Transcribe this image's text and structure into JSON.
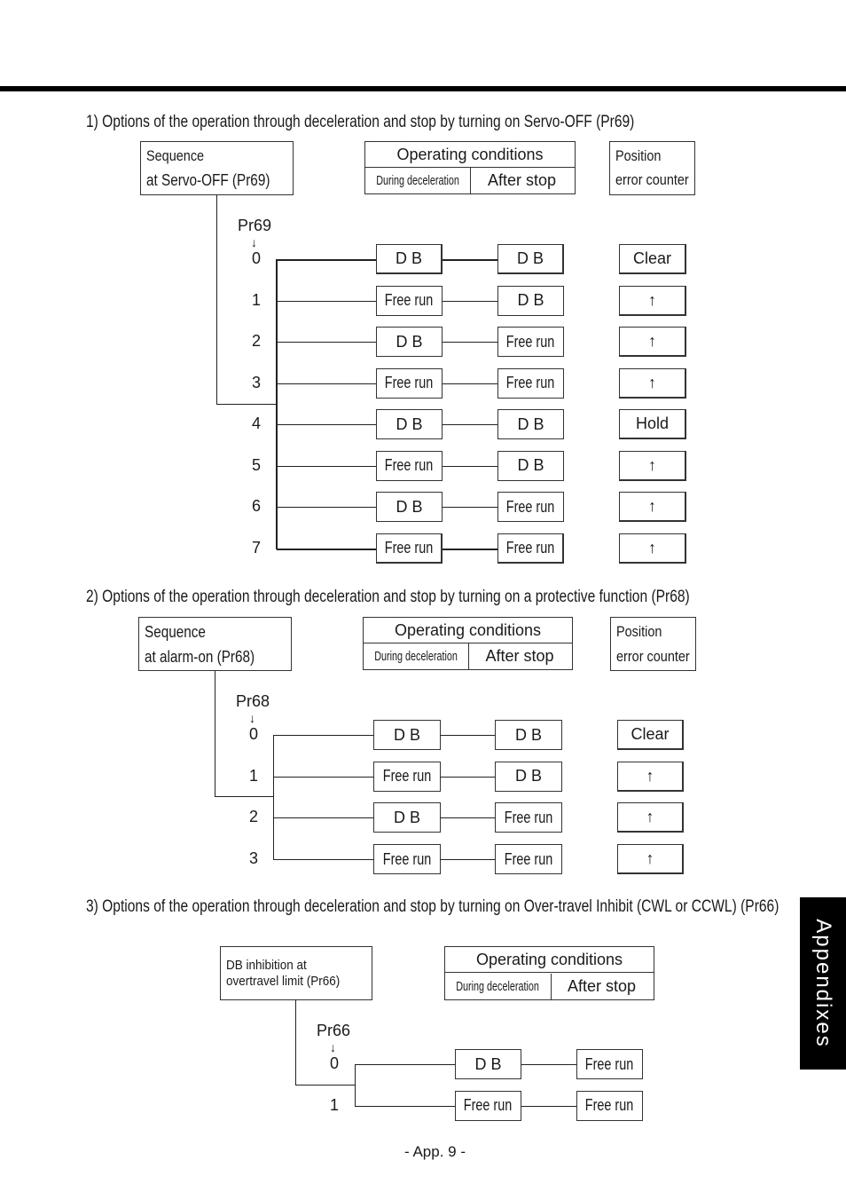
{
  "page": {
    "footer": "- App. 9 -",
    "side_tab": "Appendixes"
  },
  "section1": {
    "heading": "1) Options of the operation through deceleration and stop by turning on Servo-OFF (Pr69)",
    "seq_box": [
      "Sequence",
      "at Servo-OFF (Pr69)"
    ],
    "op_conditions": {
      "title": "Operating conditions",
      "during": "During deceleration",
      "after": "After stop"
    },
    "pos_box": [
      "Position",
      "error counter"
    ],
    "param": "Pr69",
    "arrow": "↓",
    "rows": [
      {
        "value": "0",
        "during": "D   B",
        "after": "D   B",
        "counter": "Clear"
      },
      {
        "value": "1",
        "during": "Free run",
        "after": "D   B",
        "counter": "↑"
      },
      {
        "value": "2",
        "during": "D   B",
        "after": "Free run",
        "counter": "↑"
      },
      {
        "value": "3",
        "during": "Free run",
        "after": "Free run",
        "counter": "↑"
      },
      {
        "value": "4",
        "during": "D   B",
        "after": "D   B",
        "counter": "Hold"
      },
      {
        "value": "5",
        "during": "Free run",
        "after": "D   B",
        "counter": "↑"
      },
      {
        "value": "6",
        "during": "D   B",
        "after": "Free run",
        "counter": "↑"
      },
      {
        "value": "7",
        "during": "Free run",
        "after": "Free run",
        "counter": "↑"
      }
    ]
  },
  "section2": {
    "heading": "2) Options of the operation through deceleration and stop by turning on a protective function (Pr68)",
    "seq_box": [
      "Sequence",
      "at alarm-on (Pr68)"
    ],
    "op_conditions": {
      "title": "Operating conditions",
      "during": "During deceleration",
      "after": "After stop"
    },
    "pos_box": [
      "Position",
      "error counter"
    ],
    "param": "Pr68",
    "arrow": "↓",
    "rows": [
      {
        "value": "0",
        "during": "D   B",
        "after": "D  B",
        "counter": "Clear"
      },
      {
        "value": "1",
        "during": "Free run",
        "after": "D  B",
        "counter": "↑"
      },
      {
        "value": "2",
        "during": "D  B",
        "after": "Free run",
        "counter": "↑"
      },
      {
        "value": "3",
        "during": "Free run",
        "after": "Free run",
        "counter": "↑"
      }
    ]
  },
  "section3": {
    "heading": "3) Options of the operation through deceleration and stop by turning on Over-travel Inhibit (CWL or CCWL) (Pr66)",
    "seq_box": [
      "DB inhibition at",
      "overtravel limit (Pr66)"
    ],
    "op_conditions": {
      "title": "Operating conditions",
      "during": "During deceleration",
      "after": "After stop"
    },
    "param": "Pr66",
    "arrow": "↓",
    "rows": [
      {
        "value": "0",
        "during": "D   B",
        "after": "Free run"
      },
      {
        "value": "1",
        "during": "Free run",
        "after": "Free run"
      }
    ]
  }
}
